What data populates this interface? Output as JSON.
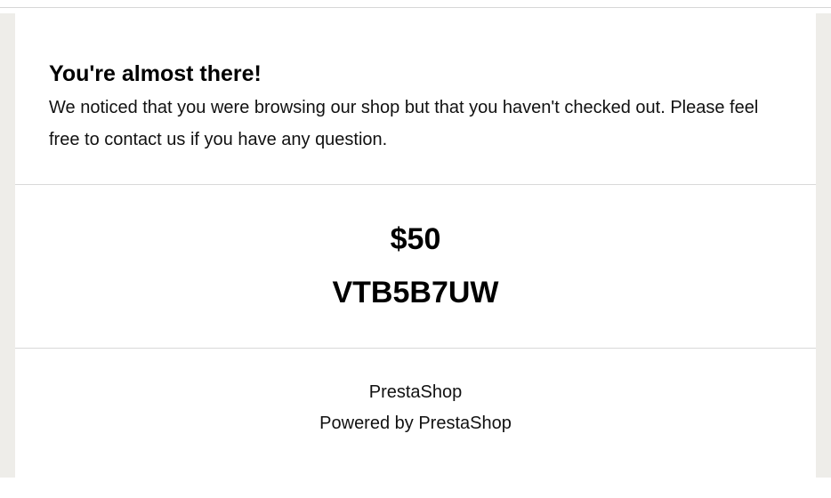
{
  "email": {
    "intro": {
      "title": "You're almost there!",
      "body": "We noticed that you were browsing our shop but that you haven't checked out. Please feel free to contact us if you have any question."
    },
    "voucher": {
      "amount": "$50",
      "code": "VTB5B7UW"
    },
    "footer": {
      "shop_name": "PrestaShop",
      "powered_by": "Powered by PrestaShop"
    }
  },
  "colors": {
    "page_background": "#ffffff",
    "side_gutter": "#eeede9",
    "divider": "#d9d9d9",
    "text": "#111111"
  }
}
